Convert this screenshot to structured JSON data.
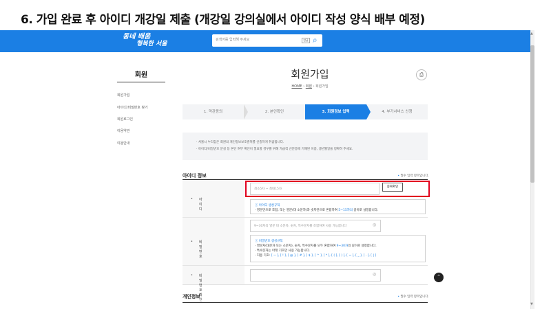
{
  "caption": "6. 가입 완료 후 아이디 개강일 제출 (개강일 강의실에서 아이디 작성 양식 배부 예정)",
  "header": {
    "logo_line1": "동네 배움",
    "logo_line2": "행복한 서울",
    "search_placeholder": "검색어를 입력해 주세요",
    "kbd_label": "한글"
  },
  "sidebar": {
    "title": "회원",
    "items": [
      "회원가입",
      "아이디/비밀번호 찾기",
      "회원로그인",
      "이용약관",
      "이용안내"
    ]
  },
  "page": {
    "title": "회원가입",
    "breadcrumb": [
      "HOME",
      "회원",
      "회원가입"
    ]
  },
  "steps": [
    {
      "label": "1. 약관동의",
      "active": false
    },
    {
      "label": "2. 본인확인",
      "active": false
    },
    {
      "label": "3. 회원정보 입력",
      "active": true
    },
    {
      "label": "4. 부가서비스 신청",
      "active": false
    }
  ],
  "notice": [
    "· 서울시 누리집은 회원의 개인정보보호준처를 신중하게 취급합니다.",
    "· 아이디/비밀번호 분실 등 본인 여부 확인이 필요할 경우를 위해 가급적 신분증에 기재된 이름, 생년월일을 정확히 주세요."
  ],
  "id_section": {
    "title": "아이디 정보",
    "required_note": "필수 입력 항목입니다.",
    "id_label": "아이디",
    "id_placeholder": "최소5자 ~ 최대15자",
    "dup_button": "중복확인",
    "id_rule_title": "ⓘ 아이디 생성규칙",
    "id_rule_text_a": "· 영문만으로 조합, 또는 영문(대 소문자)과 숫자만으로 혼합하여 ",
    "id_rule_text_hl": "5~15자의",
    "id_rule_text_b": " 길이로 설정합니다.",
    "pw_label": "비밀번호",
    "pw_placeholder": "9~30자의 영문 대 소문자, 숫자, 특수문자를 조합하여 사용 가능합니다",
    "pw_rule_title": "ⓘ 비밀번호 생성규칙",
    "pw_rule_line1_a": "· 영문자(대문자 또는 소문자), 숫자, 특수문자를 모두 혼합하여 ",
    "pw_rule_line1_hl": "9~30자",
    "pw_rule_line1_b": "의 길이로 설정합니다.",
    "pw_rule_line2": "· 특수문자는 아래 기호만 사용 가능합니다.",
    "pw_rule_line3_a": "· 허용 기호: ",
    "pw_rule_line3_b": "[ ~ ], [ ! ], [ @ ], [ # ], [ $ ], [ ^ ], [ * ], [ ( ], [ ) ], [ = ], [ _ ], [ . ], [ | ]",
    "pw_confirm_label": "비밀번호 확인"
  },
  "personal_section": {
    "title": "개인정보",
    "required_note": "필수 입력 항목입니다."
  },
  "icons": {
    "search": "search-icon",
    "print": "print-icon",
    "eye": "eye-icon",
    "top": "scroll-top-icon"
  },
  "colors": {
    "brand_blue": "#1b7fe4",
    "highlight_red": "#e1001e"
  }
}
